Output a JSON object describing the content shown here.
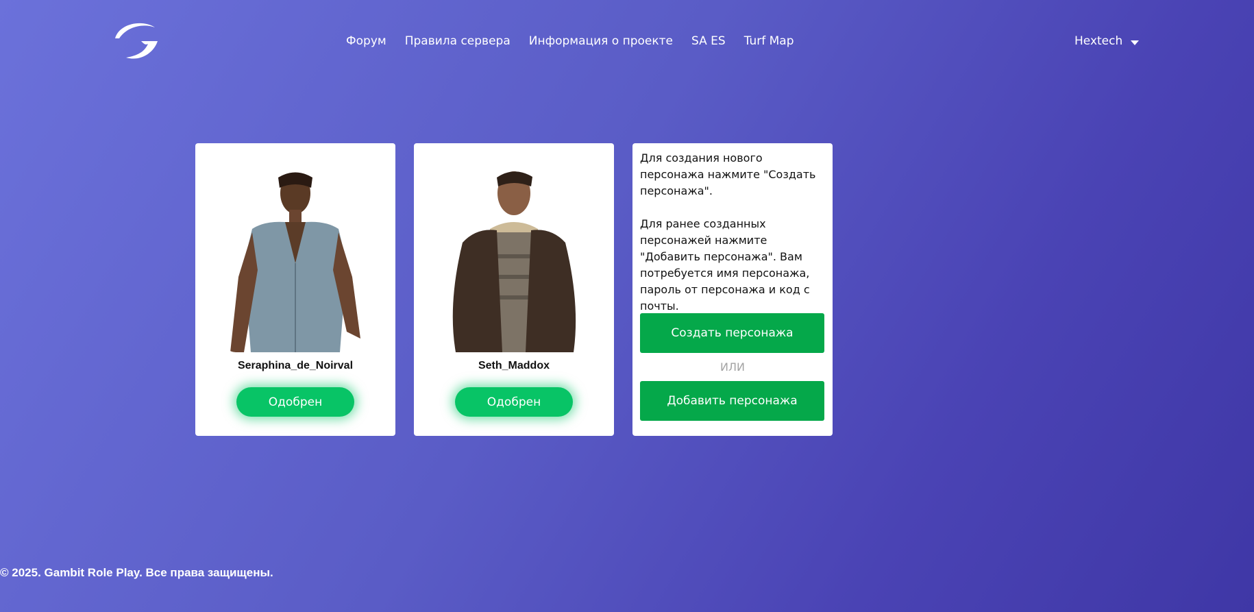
{
  "header": {
    "logo_icon": "gambit-g-logo-icon",
    "nav": [
      {
        "label": "Форум"
      },
      {
        "label": "Правила сервера"
      },
      {
        "label": "Информация о проекте"
      },
      {
        "label": "SA ES"
      },
      {
        "label": "Turf Map"
      }
    ],
    "user": {
      "name": "Hextech",
      "icon": "chevron-down-icon"
    }
  },
  "characters": [
    {
      "name": "Seraphina_de_Noirval",
      "status": "Одобрен"
    },
    {
      "name": "Seth_Maddox",
      "status": "Одобрен"
    }
  ],
  "create_panel": {
    "text1": "Для создания нового персонажа нажмите \"Создать персонажа\".",
    "text2": "Для ранее созданных персонажей нажмите \"Добавить персонажа\". Вам потребуется имя персонажа, пароль от персонажа и код с почты.",
    "create_label": "Создать персонажа",
    "or_label": "ИЛИ",
    "add_label": "Добавить персонажа"
  },
  "footer": {
    "copyright": "© 2025. Gambit Role Play. Все права защищены."
  },
  "colors": {
    "accent_green": "#05a84a",
    "status_green": "#08c466",
    "bg_start": "#6b71da",
    "bg_end": "#3f37a6"
  }
}
